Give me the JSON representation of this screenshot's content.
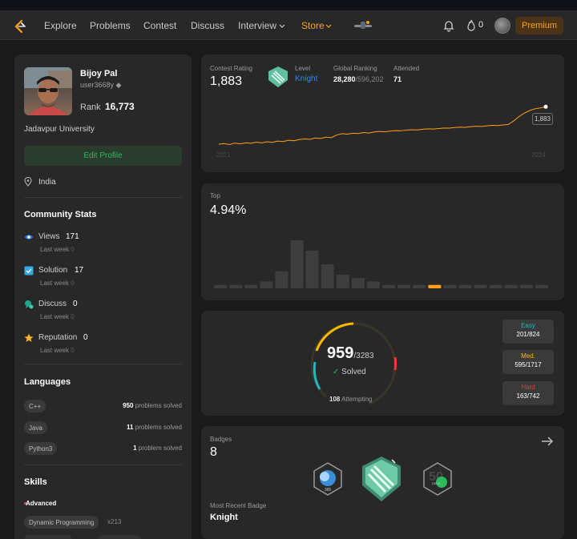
{
  "nav": {
    "items": [
      "Explore",
      "Problems",
      "Contest",
      "Discuss",
      "Interview",
      "Store"
    ],
    "streak": "0",
    "premium": "Premium"
  },
  "profile": {
    "name": "Bijoy Pal",
    "handle": "user3668y",
    "rank_label": "Rank",
    "rank": "16,773",
    "university": "Jadavpur University",
    "edit_label": "Edit Profile",
    "location": "India"
  },
  "community": {
    "title": "Community Stats",
    "week_label": "Last week",
    "items": [
      {
        "label": "Views",
        "value": "171",
        "delta": "0",
        "icon": "eye-icon"
      },
      {
        "label": "Solution",
        "value": "17",
        "delta": "0",
        "icon": "checkbox-icon"
      },
      {
        "label": "Discuss",
        "value": "0",
        "delta": "0",
        "icon": "discuss-icon"
      },
      {
        "label": "Reputation",
        "value": "0",
        "delta": "0",
        "icon": "star-icon"
      }
    ]
  },
  "languages": {
    "title": "Languages",
    "items": [
      {
        "name": "C++",
        "count": "950",
        "suffix": "problems solved"
      },
      {
        "name": "Java",
        "count": "11",
        "suffix": "problems solved"
      },
      {
        "name": "Python3",
        "count": "1",
        "suffix": "problem solved"
      }
    ]
  },
  "skills": {
    "title": "Skills",
    "level": "Advanced",
    "items": [
      {
        "name": "Dynamic Programming",
        "count": "x213"
      }
    ]
  },
  "contest": {
    "rating_label": "Contest Rating",
    "rating": "1,883",
    "level_label": "Level",
    "level": "Knight",
    "global_label": "Global Ranking",
    "global_rank": "28,280",
    "global_total": "/596,202",
    "attended_label": "Attended",
    "attended": "71",
    "tooltip": "1,883",
    "start_year": "2021",
    "end_year": "2024",
    "accent": "#ffa116"
  },
  "top": {
    "label": "Top",
    "value": "4.94%"
  },
  "chart_data": [
    {
      "type": "line",
      "title": "Contest Rating",
      "x_tick_labels": [
        "2021",
        "2024"
      ],
      "series": [
        {
          "values": [
            1455,
            1462,
            1450,
            1468,
            1458,
            1470,
            1465,
            1478,
            1470,
            1482,
            1476,
            1490,
            1485,
            1500,
            1494,
            1508,
            1515,
            1510,
            1525,
            1520,
            1535,
            1530,
            1560,
            1575,
            1570,
            1580,
            1576,
            1588,
            1582,
            1595,
            1600,
            1596,
            1605,
            1610,
            1608,
            1616,
            1620,
            1618,
            1626,
            1630,
            1628,
            1634,
            1640,
            1638,
            1645,
            1650,
            1648,
            1655,
            1660,
            1658,
            1665,
            1670,
            1668,
            1675,
            1680,
            1720,
            1770,
            1810,
            1840,
            1860,
            1870,
            1883
          ]
        }
      ],
      "ylim": [
        1400,
        1950
      ]
    },
    {
      "type": "bar",
      "title": "Top",
      "values": [
        1,
        1,
        1,
        2,
        5,
        14,
        11,
        7,
        4,
        3,
        2,
        1,
        1,
        1,
        1,
        1,
        1,
        1,
        1,
        1,
        1,
        1
      ],
      "highlight_index": 14
    }
  ],
  "solved": {
    "total": "959",
    "of": "/3283",
    "solved_label": "Solved",
    "attempting": "108",
    "attempting_label": "Attempting",
    "easy": {
      "label": "Easy",
      "value": "201/824",
      "color": "#1cbaba"
    },
    "medium": {
      "label": "Med.",
      "value": "595/1717",
      "color": "#ffb700"
    },
    "hard": {
      "label": "Hard",
      "value": "163/742",
      "color": "#f63737"
    }
  },
  "badges": {
    "label": "Badges",
    "count": "8",
    "recent_label": "Most Recent Badge",
    "recent": "Knight"
  }
}
